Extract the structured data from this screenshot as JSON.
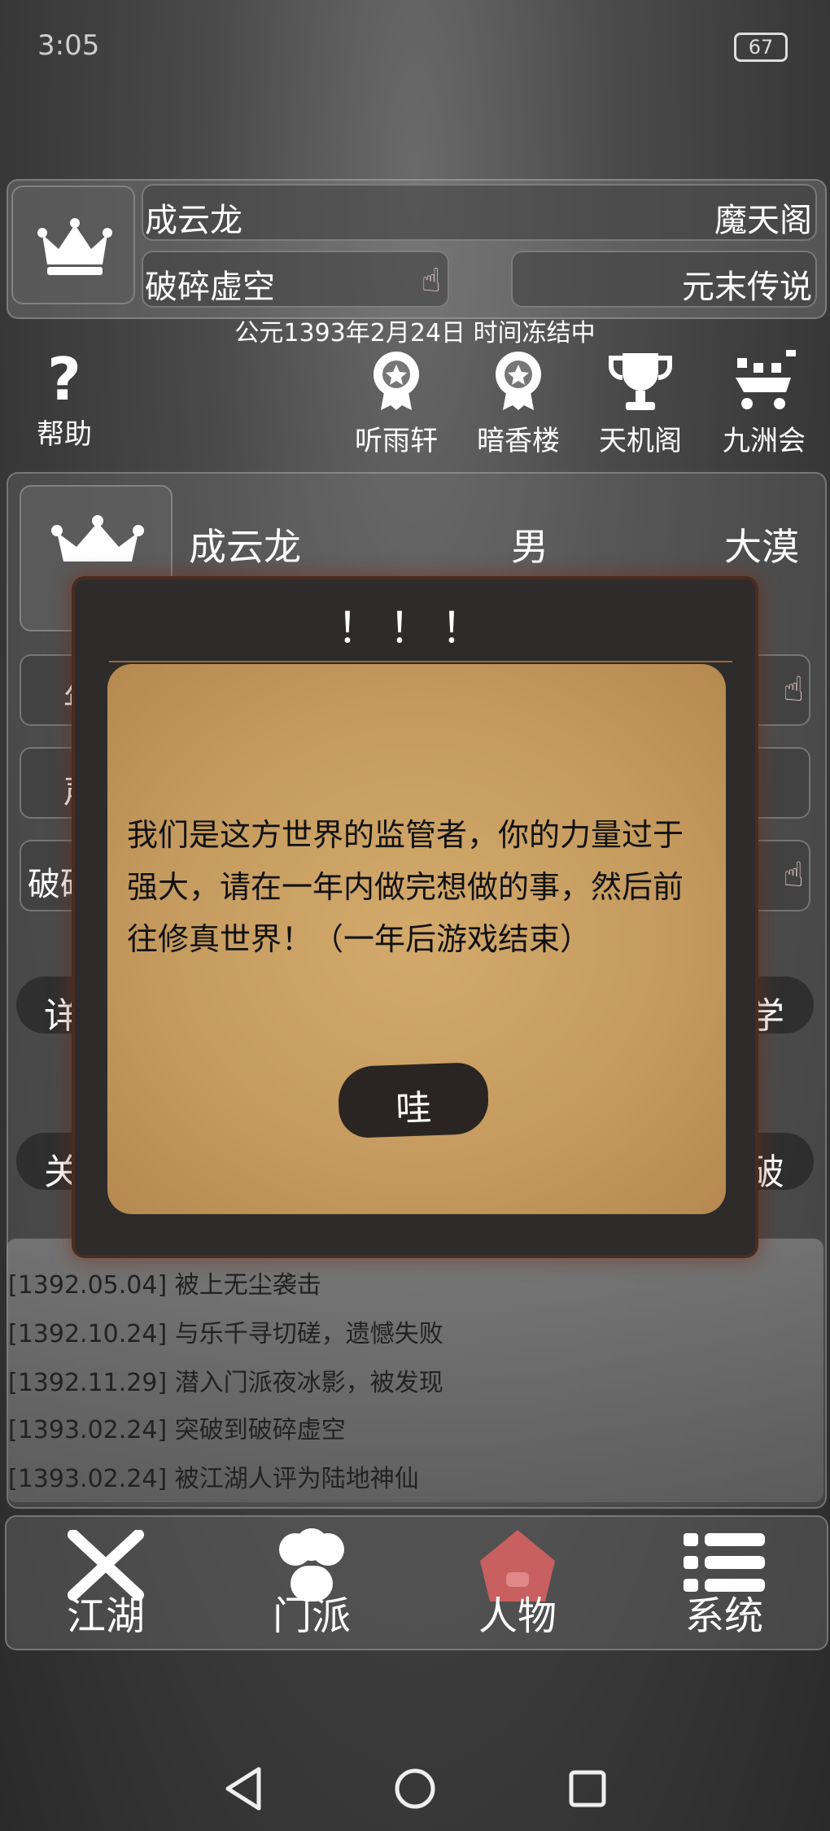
{
  "status_bar": {
    "time": "3:05",
    "battery": "67"
  },
  "header": {
    "name": "成云龙",
    "sect": "魔天阁",
    "realm": "破碎虚空",
    "era": "元末传说",
    "date_line": "公元1393年2月24日 时间冻结中"
  },
  "top_icons": [
    {
      "label": "帮助",
      "icon": "question-icon"
    },
    {
      "label": "听雨轩",
      "icon": "medal-icon"
    },
    {
      "label": "暗香楼",
      "icon": "medal-icon"
    },
    {
      "label": "天机阁",
      "icon": "trophy-icon"
    },
    {
      "label": "九洲会",
      "icon": "cart-icon"
    }
  ],
  "profile": {
    "name": "成云龙",
    "gender": "男",
    "region": "大漠",
    "row1_partial": "年",
    "row2_partial": "声",
    "row3_partial": "破碎",
    "btn_left1": "详",
    "btn_left2": "关",
    "btn_right1": "学",
    "btn_right2": "破"
  },
  "dialog": {
    "title": "！！！",
    "message": "我们是这方世界的监管者，你的力量过于强大，请在一年内做完想做的事，然后前往修真世界！（一年后游戏结束）",
    "confirm": "哇"
  },
  "log": [
    "[1392.05.04] 被上无尘袭击",
    "[1392.10.24] 与乐千寻切磋，遗憾失败",
    "[1392.11.29] 潜入门派夜冰影，被发现",
    "[1393.02.24] 突破到破碎虚空",
    "[1393.02.24] 被江湖人评为陆地神仙"
  ],
  "bottom_nav": [
    {
      "label": "江湖",
      "icon": "swords-icon"
    },
    {
      "label": "门派",
      "icon": "group-icon"
    },
    {
      "label": "人物",
      "icon": "house-icon",
      "active": true
    },
    {
      "label": "系统",
      "icon": "menu-icon"
    }
  ],
  "colors": {
    "active_nav": "#c86060",
    "parchment": "#c49a5e",
    "dialog_frame": "#2e2b2b"
  }
}
